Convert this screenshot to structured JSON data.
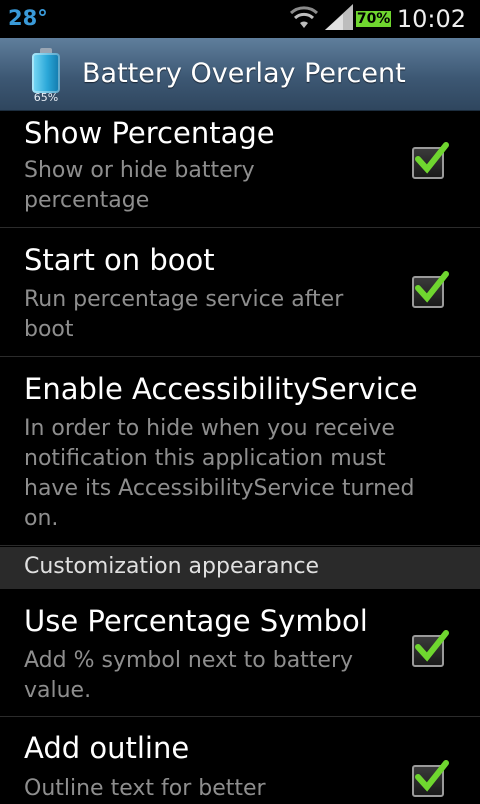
{
  "status_bar": {
    "temperature": "28°",
    "battery_percent": "70%",
    "time": "10:02",
    "icons": [
      "wifi-icon",
      "signal-icon",
      "battery-icon"
    ]
  },
  "title_bar": {
    "app_icon_label": "65%",
    "title": "Battery Overlay Percent"
  },
  "settings": [
    {
      "title": "Show Percentage",
      "summary": "Show or hide battery percentage",
      "checked": true
    },
    {
      "title": "Start on boot",
      "summary": "Run percentage service after boot",
      "checked": true
    },
    {
      "title": "Enable AccessibilityService",
      "summary": "In order to hide when you receive notification this application must have its AccessibilityService turned on."
    }
  ],
  "section": {
    "label": "Customization appearance"
  },
  "appearance": [
    {
      "title": "Use Percentage Symbol",
      "summary": "Add % symbol next to battery value.",
      "checked": true
    },
    {
      "title": "Add outline",
      "summary": "Outline text for better",
      "checked": true
    }
  ],
  "colors": {
    "accent_blue": "#3a9ad9",
    "check_green": "#6fd62f",
    "title_bar": "#3d5874"
  }
}
